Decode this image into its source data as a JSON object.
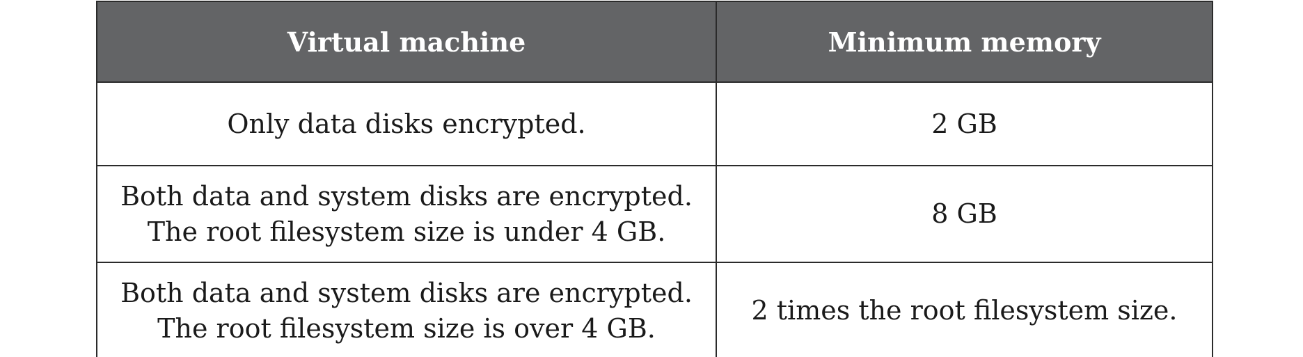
{
  "table": {
    "headers": [
      "Virtual machine",
      "Minimum memory"
    ],
    "rows": [
      {
        "vm_lines": [
          "Only data disks encrypted."
        ],
        "memory": "2 GB"
      },
      {
        "vm_lines": [
          "Both data and system disks are encrypted.",
          "The root filesystem size is under 4 GB."
        ],
        "memory": "8 GB"
      },
      {
        "vm_lines": [
          "Both data and system disks are encrypted.",
          "The root filesystem size is over 4 GB."
        ],
        "memory": "2 times the root filesystem size."
      }
    ]
  }
}
